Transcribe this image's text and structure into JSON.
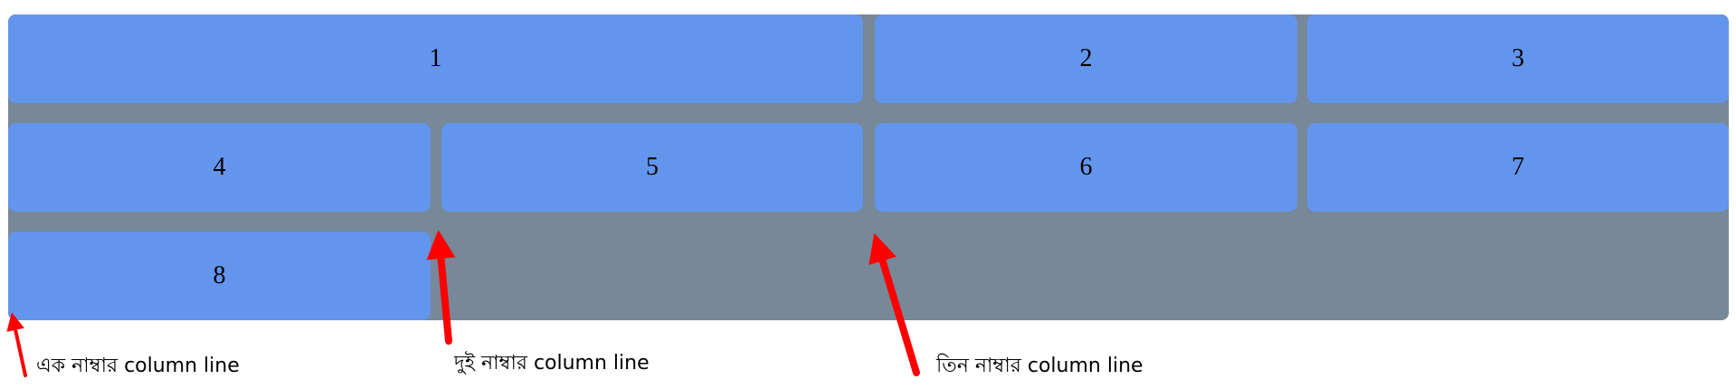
{
  "grid": {
    "background": "#778899",
    "item_color": "#6495ed",
    "items": [
      {
        "label": "1"
      },
      {
        "label": "2"
      },
      {
        "label": "3"
      },
      {
        "label": "4"
      },
      {
        "label": "5"
      },
      {
        "label": "6"
      },
      {
        "label": "7"
      },
      {
        "label": "8"
      }
    ]
  },
  "annotations": {
    "arrow_color": "#ff0000",
    "line1": "এক নাম্বার column line",
    "line2": "দুই নাম্বার column line",
    "line3": "তিন নাম্বার column line"
  }
}
